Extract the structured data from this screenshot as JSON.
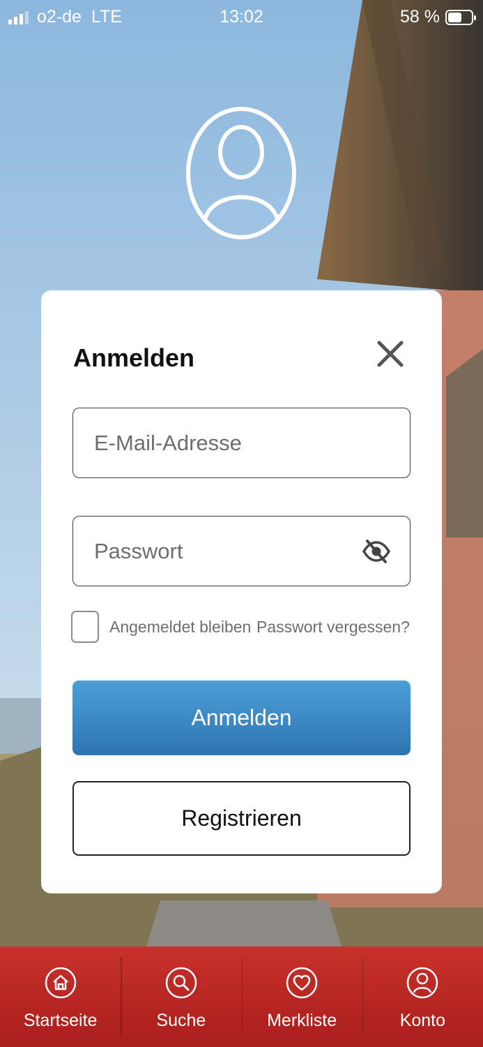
{
  "status_bar": {
    "carrier": "o2-de",
    "network": "LTE",
    "time": "13:02",
    "battery_text": "58 %",
    "battery_level": 0.58
  },
  "login": {
    "title": "Anmelden",
    "email_placeholder": "E-Mail-Adresse",
    "password_placeholder": "Passwort",
    "remember_label": "Angemeldet bleiben",
    "forgot_label": "Passwort vergessen?",
    "submit_label": "Anmelden",
    "register_label": "Registrieren"
  },
  "nav": {
    "items": [
      {
        "label": "Startseite",
        "icon": "home-icon"
      },
      {
        "label": "Suche",
        "icon": "search-icon"
      },
      {
        "label": "Merkliste",
        "icon": "heart-icon"
      },
      {
        "label": "Konto",
        "icon": "user-icon"
      }
    ]
  },
  "colors": {
    "primary_button": "#3f8ccb",
    "nav_background": "#b9261f",
    "text_dark": "#111111",
    "text_muted": "#6e6e6e"
  }
}
